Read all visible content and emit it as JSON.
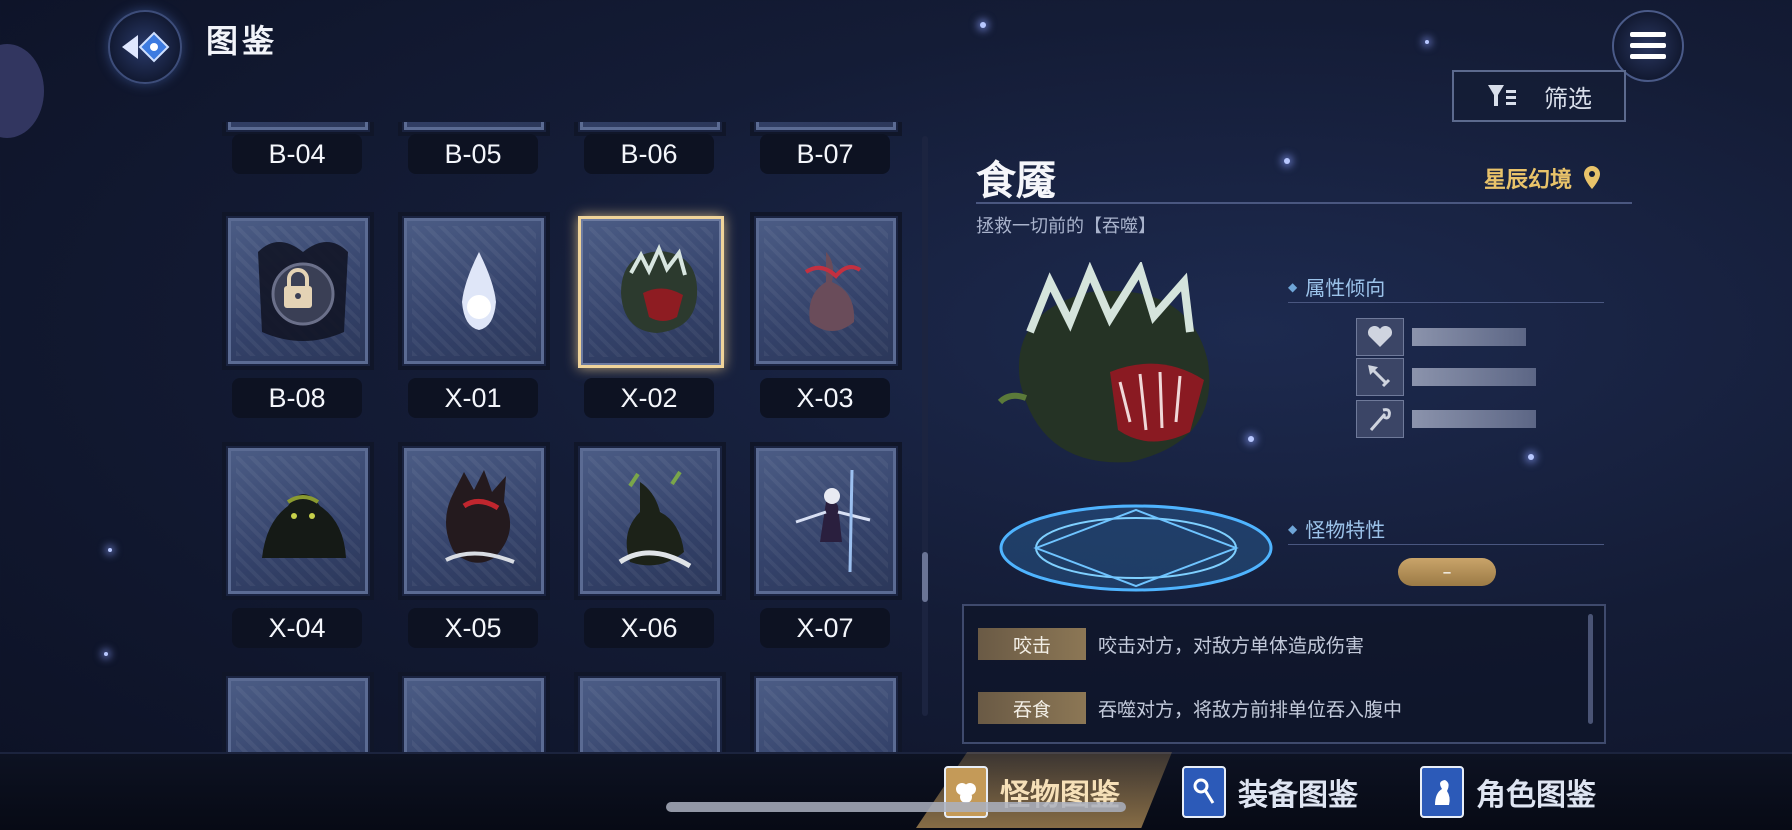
{
  "header": {
    "title": "图鉴"
  },
  "filter": {
    "label": "筛选"
  },
  "grid": {
    "cells": [
      {
        "label": "B-04",
        "state": "partial"
      },
      {
        "label": "B-05",
        "state": "partial"
      },
      {
        "label": "B-06",
        "state": "partial"
      },
      {
        "label": "B-07",
        "state": "partial"
      },
      {
        "label": "B-08",
        "state": "locked"
      },
      {
        "label": "X-01",
        "state": "unlocked"
      },
      {
        "label": "X-02",
        "state": "selected"
      },
      {
        "label": "X-03",
        "state": "unlocked"
      },
      {
        "label": "X-04",
        "state": "unlocked"
      },
      {
        "label": "X-05",
        "state": "unlocked"
      },
      {
        "label": "X-06",
        "state": "unlocked"
      },
      {
        "label": "X-07",
        "state": "unlocked"
      }
    ]
  },
  "detail": {
    "name": "食魇",
    "location": "星辰幻境",
    "subtitle": "拯救一切前的【吞噬】",
    "attributes_title": "属性倾向",
    "attributes": [
      {
        "icon": "heart-icon",
        "value": 0.6
      },
      {
        "icon": "sword-icon",
        "value": 0.65
      },
      {
        "icon": "staff-icon",
        "value": 0.65
      }
    ],
    "traits_title": "怪物特性",
    "trait_badge": "–",
    "skills": [
      {
        "name": "咬击",
        "desc": "咬击对方，对敌方单体造成伤害"
      },
      {
        "name": "吞食",
        "desc": "吞噬对方，将敌方前排单位吞入腹中"
      }
    ]
  },
  "tabs": [
    {
      "label": "怪物图鉴",
      "active": true
    },
    {
      "label": "装备图鉴",
      "active": false
    },
    {
      "label": "角色图鉴",
      "active": false
    }
  ],
  "colors": {
    "accent_gold": "#e9c36a",
    "selected_border": "#f0d49a",
    "section_blue": "#9cc3ea"
  }
}
